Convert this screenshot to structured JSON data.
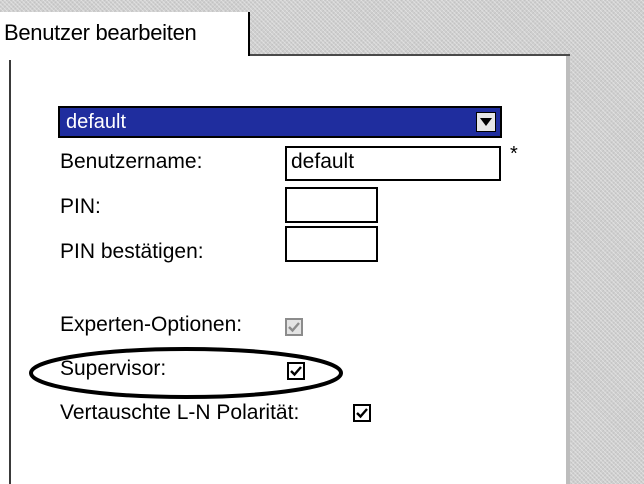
{
  "tab": {
    "title": "Benutzer bearbeiten"
  },
  "form": {
    "user_select": {
      "value": "default"
    },
    "username": {
      "label": "Benutzername:",
      "value": "default",
      "required_marker": "*"
    },
    "pin": {
      "label": "PIN:",
      "value": ""
    },
    "pin_confirm": {
      "label": "PIN bestätigen:",
      "value": ""
    },
    "expert_options": {
      "label": "Experten-Optionen:",
      "checked": true,
      "enabled": false
    },
    "supervisor": {
      "label": "Supervisor:",
      "checked": true,
      "enabled": true,
      "highlighted": true
    },
    "polarity": {
      "label": "Vertauschte L-N Polarität:",
      "checked": true,
      "enabled": true
    }
  },
  "colors": {
    "selection_bg": "#1f2d9e",
    "annotation": "#000000",
    "background_pattern": "#cfcfcf"
  },
  "icons": {
    "dropdown": "chevron-down-icon",
    "check": "checkmark-icon"
  }
}
